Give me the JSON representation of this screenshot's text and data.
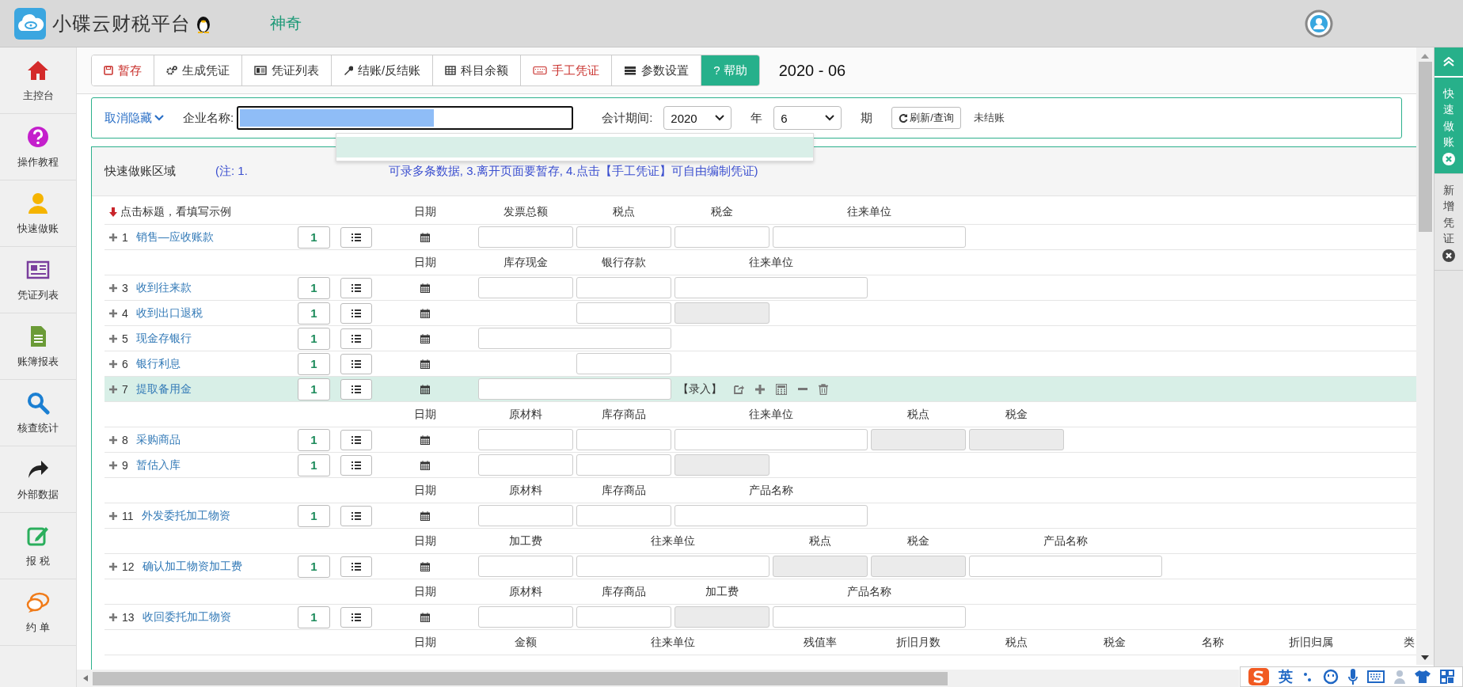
{
  "header": {
    "app_title": "小碟云财税平台",
    "company_prefix": "神奇"
  },
  "sidebar": [
    {
      "label": "主控台"
    },
    {
      "label": "操作教程"
    },
    {
      "label": "快速做账"
    },
    {
      "label": "凭证列表"
    },
    {
      "label": "账簿报表"
    },
    {
      "label": "核查统计"
    },
    {
      "label": "外部数据"
    },
    {
      "label": "报 税"
    },
    {
      "label": "约 单"
    }
  ],
  "toolbar": [
    {
      "label": "暂存",
      "kind": "danger"
    },
    {
      "label": "生成凭证",
      "kind": "default"
    },
    {
      "label": "凭证列表",
      "kind": "default"
    },
    {
      "label": "结账/反结账",
      "kind": "default"
    },
    {
      "label": "科目余额",
      "kind": "default"
    },
    {
      "label": "手工凭证",
      "kind": "danger"
    },
    {
      "label": "参数设置",
      "kind": "default"
    },
    {
      "label": "? 帮助",
      "kind": "primary"
    }
  ],
  "period_display": "2020 - 06",
  "filter": {
    "toggle": "取消隐藏",
    "company_label": "企业名称:",
    "company_dropdown_open": true,
    "period_label": "会计期间:",
    "year": "2020",
    "year_unit": "年",
    "period": "6",
    "period_unit": "期",
    "refresh": "刷新/查询",
    "status": "未结账"
  },
  "quick_entry": {
    "title": "快速做账区域",
    "note_start": "(注: 1.",
    "note_end": "可录多条数据, 3.离开页面要暂存, 4.点击【手工凭证】可自由编制凭证)",
    "groups": [
      {
        "hint": "点击标题，看填写示例",
        "date_label": "日期",
        "columns": [
          {
            "label": "发票总额",
            "kind": "narrow"
          },
          {
            "label": "税点",
            "kind": "narrow"
          },
          {
            "label": "税金",
            "kind": "narrow"
          },
          {
            "label": "往来单位",
            "kind": "wide"
          }
        ],
        "rows": [
          {
            "number": "1",
            "label": "销售—应收账款",
            "count": "1",
            "selected": false,
            "fields": [
              {
                "kind": "input"
              },
              {
                "kind": "input"
              },
              {
                "kind": "input"
              },
              {
                "kind": "wide"
              }
            ]
          }
        ]
      },
      {
        "date_label": "日期",
        "columns": [
          {
            "label": "库存现金",
            "kind": "narrow"
          },
          {
            "label": "银行存款",
            "kind": "narrow"
          },
          {
            "label": "往来单位",
            "kind": "wide"
          }
        ],
        "rows": [
          {
            "number": "3",
            "label": "收到往来款",
            "count": "1",
            "selected": false,
            "fields": [
              {
                "kind": "input"
              },
              {
                "kind": "input"
              },
              {
                "kind": "wide"
              }
            ]
          },
          {
            "number": "4",
            "label": "收到出口退税",
            "count": "1",
            "selected": false,
            "fields": [
              {
                "kind": "blank"
              },
              {
                "kind": "input"
              },
              {
                "kind": "readonly"
              }
            ]
          },
          {
            "number": "5",
            "label": "现金存银行",
            "count": "1",
            "selected": false,
            "fields": [
              {
                "kind": "wide"
              }
            ]
          },
          {
            "number": "6",
            "label": "银行利息",
            "count": "1",
            "selected": false,
            "fields": [
              {
                "kind": "blank"
              },
              {
                "kind": "input"
              }
            ]
          },
          {
            "number": "7",
            "label": "提取备用金",
            "count": "1",
            "selected": true,
            "fields": [
              {
                "kind": "wide"
              }
            ],
            "entry_label": "【录入】"
          }
        ]
      },
      {
        "date_label": "日期",
        "columns": [
          {
            "label": "原材料",
            "kind": "narrow"
          },
          {
            "label": "库存商品",
            "kind": "narrow"
          },
          {
            "label": "往来单位",
            "kind": "wide"
          },
          {
            "label": "税点",
            "kind": "narrow"
          },
          {
            "label": "税金",
            "kind": "narrow"
          }
        ],
        "rows": [
          {
            "number": "8",
            "label": "采购商品",
            "count": "1",
            "selected": false,
            "fields": [
              {
                "kind": "input"
              },
              {
                "kind": "input"
              },
              {
                "kind": "wide"
              },
              {
                "kind": "readonly"
              },
              {
                "kind": "readonly"
              }
            ]
          },
          {
            "number": "9",
            "label": "暂估入库",
            "count": "1",
            "selected": false,
            "fields": [
              {
                "kind": "input"
              },
              {
                "kind": "input"
              },
              {
                "kind": "readonly"
              }
            ]
          }
        ]
      },
      {
        "date_label": "日期",
        "columns": [
          {
            "label": "原材料",
            "kind": "narrow"
          },
          {
            "label": "库存商品",
            "kind": "narrow"
          },
          {
            "label": "产品名称",
            "kind": "wide"
          }
        ],
        "rows": [
          {
            "number": "11",
            "label": "外发委托加工物资",
            "count": "1",
            "selected": false,
            "fields": [
              {
                "kind": "input"
              },
              {
                "kind": "input"
              },
              {
                "kind": "wide"
              }
            ]
          }
        ]
      },
      {
        "date_label": "日期",
        "columns": [
          {
            "label": "加工费",
            "kind": "narrow"
          },
          {
            "label": "往来单位",
            "kind": "wide"
          },
          {
            "label": "税点",
            "kind": "narrow"
          },
          {
            "label": "税金",
            "kind": "narrow"
          },
          {
            "label": "产品名称",
            "kind": "wide"
          }
        ],
        "rows": [
          {
            "number": "12",
            "label": "确认加工物资加工费",
            "count": "1",
            "selected": false,
            "fields": [
              {
                "kind": "input"
              },
              {
                "kind": "wide"
              },
              {
                "kind": "readonly"
              },
              {
                "kind": "readonly"
              },
              {
                "kind": "wide"
              }
            ]
          }
        ]
      },
      {
        "date_label": "日期",
        "columns": [
          {
            "label": "原材料",
            "kind": "narrow"
          },
          {
            "label": "库存商品",
            "kind": "narrow"
          },
          {
            "label": "加工费",
            "kind": "narrow"
          },
          {
            "label": "产品名称",
            "kind": "wide"
          }
        ],
        "rows": [
          {
            "number": "13",
            "label": "收回委托加工物资",
            "count": "1",
            "selected": false,
            "fields": [
              {
                "kind": "input"
              },
              {
                "kind": "input"
              },
              {
                "kind": "readonly"
              },
              {
                "kind": "wide"
              }
            ]
          }
        ]
      },
      {
        "date_label": "日期",
        "columns": [
          {
            "label": "金额",
            "kind": "narrow"
          },
          {
            "label": "往来单位",
            "kind": "wide"
          },
          {
            "label": "残值率",
            "kind": "narrow"
          },
          {
            "label": "折旧月数",
            "kind": "narrow"
          },
          {
            "label": "税点",
            "kind": "narrow"
          },
          {
            "label": "税金",
            "kind": "narrow"
          },
          {
            "label": "名称",
            "kind": "narrow"
          },
          {
            "label": "折旧归属",
            "kind": "narrow"
          },
          {
            "label": "类",
            "kind": "narrow"
          }
        ]
      }
    ]
  },
  "right_rail": [
    {
      "label": "快速做账",
      "selected": true
    },
    {
      "label": "新增凭证",
      "selected": false
    }
  ],
  "ime": {
    "mode": "英"
  }
}
